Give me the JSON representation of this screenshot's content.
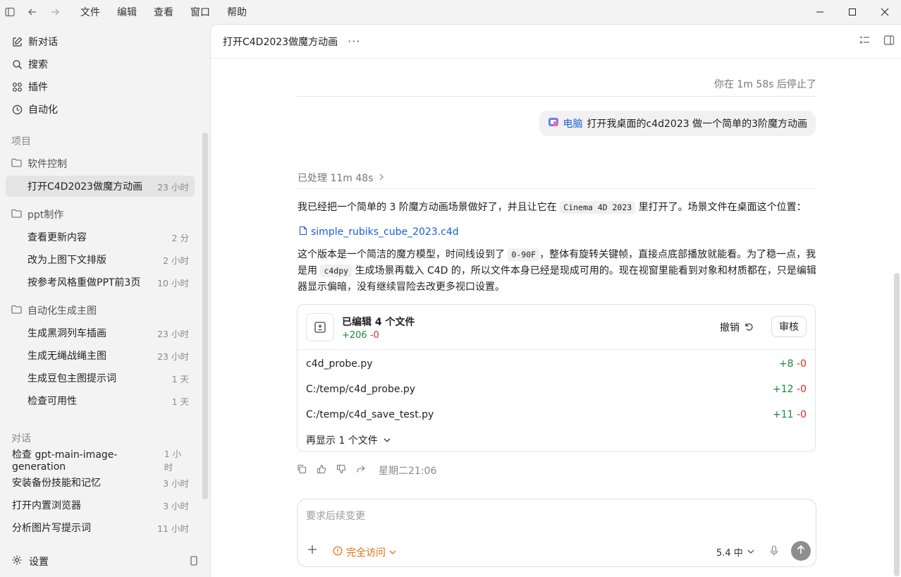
{
  "titlebar": {
    "menu": [
      "文件",
      "编辑",
      "查看",
      "窗口",
      "帮助"
    ]
  },
  "sidebar": {
    "actions": [
      {
        "label": "新对话",
        "icon": "edit-icon"
      },
      {
        "label": "搜索",
        "icon": "search-icon"
      },
      {
        "label": "插件",
        "icon": "plugins-icon"
      },
      {
        "label": "自动化",
        "icon": "clock-icon"
      }
    ],
    "projects_label": "项目",
    "folders": [
      {
        "name": "软件控制",
        "items": [
          {
            "label": "打开C4D2023做魔方动画",
            "time": "23 小时",
            "active": true
          }
        ]
      },
      {
        "name": "ppt制作",
        "items": [
          {
            "label": "查看更新内容",
            "time": "2 分"
          },
          {
            "label": "改为上图下文排版",
            "time": "2 小时"
          },
          {
            "label": "按参考风格重做PPT前3页",
            "time": "10 小时"
          }
        ]
      },
      {
        "name": "自动化生成主图",
        "items": [
          {
            "label": "生成黑洞列车插画",
            "time": "23 小时"
          },
          {
            "label": "生成无绳战绳主图",
            "time": "23 小时"
          },
          {
            "label": "生成豆包主图提示词",
            "time": "1 天"
          },
          {
            "label": "检查可用性",
            "time": "1 天"
          }
        ]
      }
    ],
    "conversations_label": "对话",
    "conversations": [
      {
        "label": "检查 gpt-main-image-generation",
        "time": "1 小时"
      },
      {
        "label": "安装备份技能和记忆",
        "time": "3 小时"
      },
      {
        "label": "打开内置浏览器",
        "time": "3 小时"
      },
      {
        "label": "分析图片写提示词",
        "time": "11 小时"
      }
    ],
    "settings_label": "设置"
  },
  "main": {
    "title": "打开C4D2023做魔方动画",
    "stopped": "你在 1m 58s 后停止了",
    "user_message": {
      "tag": "电脑",
      "text": "打开我桌面的c4d2023 做一个简单的3阶魔方动画"
    },
    "processed": "已处理 11m 48s",
    "para1_a": "我已经把一个简单的 3 阶魔方动画场景做好了，并且让它在 ",
    "para1_code": "Cinema 4D 2023",
    "para1_b": " 里打开了。场景文件在桌面这个位置：",
    "file_link": "simple_rubiks_cube_2023.c4d",
    "para2_a": "这个版本是一个简洁的魔方模型，时间线设到了 ",
    "para2_code1": "0-90F",
    "para2_b": "，整体有旋转关键帧，直接点底部播放就能看。为了稳一点，我是用 ",
    "para2_code2": "c4dpy",
    "para2_c": " 生成场景再载入 C4D 的，所以文件本身已经是现成可用的。现在视窗里能看到对象和材质都在，只是编辑器显示偏暗，没有继续冒险去改更多视口设置。",
    "edits": {
      "title": "已编辑 4 个文件",
      "plus": "+206",
      "minus": "-0",
      "undo_label": "撤销",
      "review_label": "审核",
      "files": [
        {
          "name": "c4d_probe.py",
          "plus": "+8",
          "minus": "-0"
        },
        {
          "name": "C:/temp/c4d_probe.py",
          "plus": "+12",
          "minus": "-0"
        },
        {
          "name": "C:/temp/c4d_save_test.py",
          "plus": "+11",
          "minus": "-0"
        }
      ],
      "show_more": "再显示 1 个文件"
    },
    "timestamp": "星期二21:06",
    "composer": {
      "placeholder": "要求后续变更",
      "access_label": "完全访问",
      "model_label": "5.4 中"
    }
  },
  "colors": {
    "link": "#1a5ed6",
    "plus": "#1b8a3a",
    "minus": "#d22d2d",
    "warning": "#d9730d"
  }
}
